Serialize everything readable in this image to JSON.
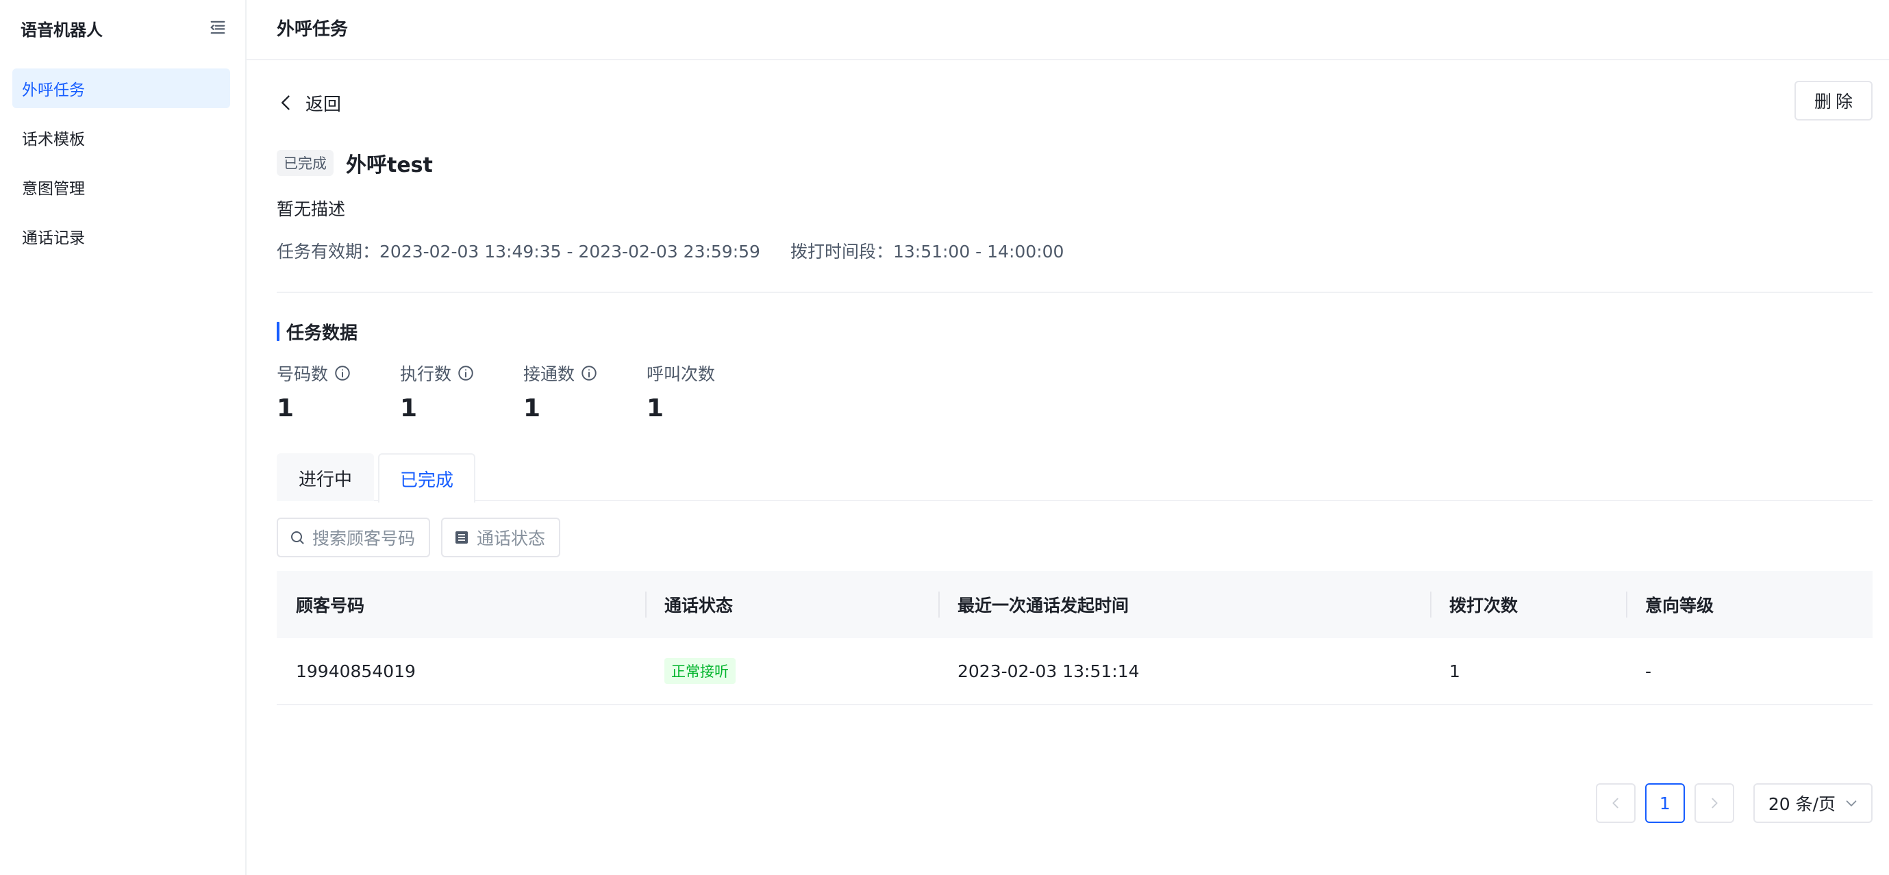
{
  "sidebar": {
    "app_title": "语音机器人",
    "items": [
      {
        "label": "外呼任务",
        "active": true
      },
      {
        "label": "话术模板",
        "active": false
      },
      {
        "label": "意图管理",
        "active": false
      },
      {
        "label": "通话记录",
        "active": false
      }
    ]
  },
  "header": {
    "title": "外呼任务"
  },
  "detail": {
    "back_label": "返回",
    "delete_label": "删除",
    "status_tag": "已完成",
    "task_name": "外呼test",
    "description": "暂无描述",
    "validity": "任务有效期：2023-02-03 13:49:35 - 2023-02-03 23:59:59",
    "dial_window": "拨打时间段：13:51:00 - 14:00:00"
  },
  "stats": {
    "section_title": "任务数据",
    "items": [
      {
        "label": "号码数",
        "value": "1",
        "info_icon": true
      },
      {
        "label": "执行数",
        "value": "1",
        "info_icon": true
      },
      {
        "label": "接通数",
        "value": "1",
        "info_icon": true
      },
      {
        "label": "呼叫次数",
        "value": "1",
        "info_icon": false
      }
    ]
  },
  "tabs": [
    {
      "label": "进行中",
      "active": false
    },
    {
      "label": "已完成",
      "active": true
    }
  ],
  "filters": {
    "search_label": "搜索顾客号码",
    "status_label": "通话状态"
  },
  "table": {
    "columns": [
      "顾客号码",
      "通话状态",
      "最近一次通话发起时间",
      "拨打次数",
      "意向等级"
    ],
    "rows": [
      {
        "phone": "19940854019",
        "status": "正常接听",
        "last_call": "2023-02-03 13:51:14",
        "dial_count": "1",
        "intent": "-"
      }
    ]
  },
  "pagination": {
    "current_page": "1",
    "page_size": "20 条/页"
  },
  "colors": {
    "accent": "#165dff",
    "active_nav_bg": "#e8f3ff",
    "success": "#00b42a",
    "success_bg": "#e8ffea"
  }
}
